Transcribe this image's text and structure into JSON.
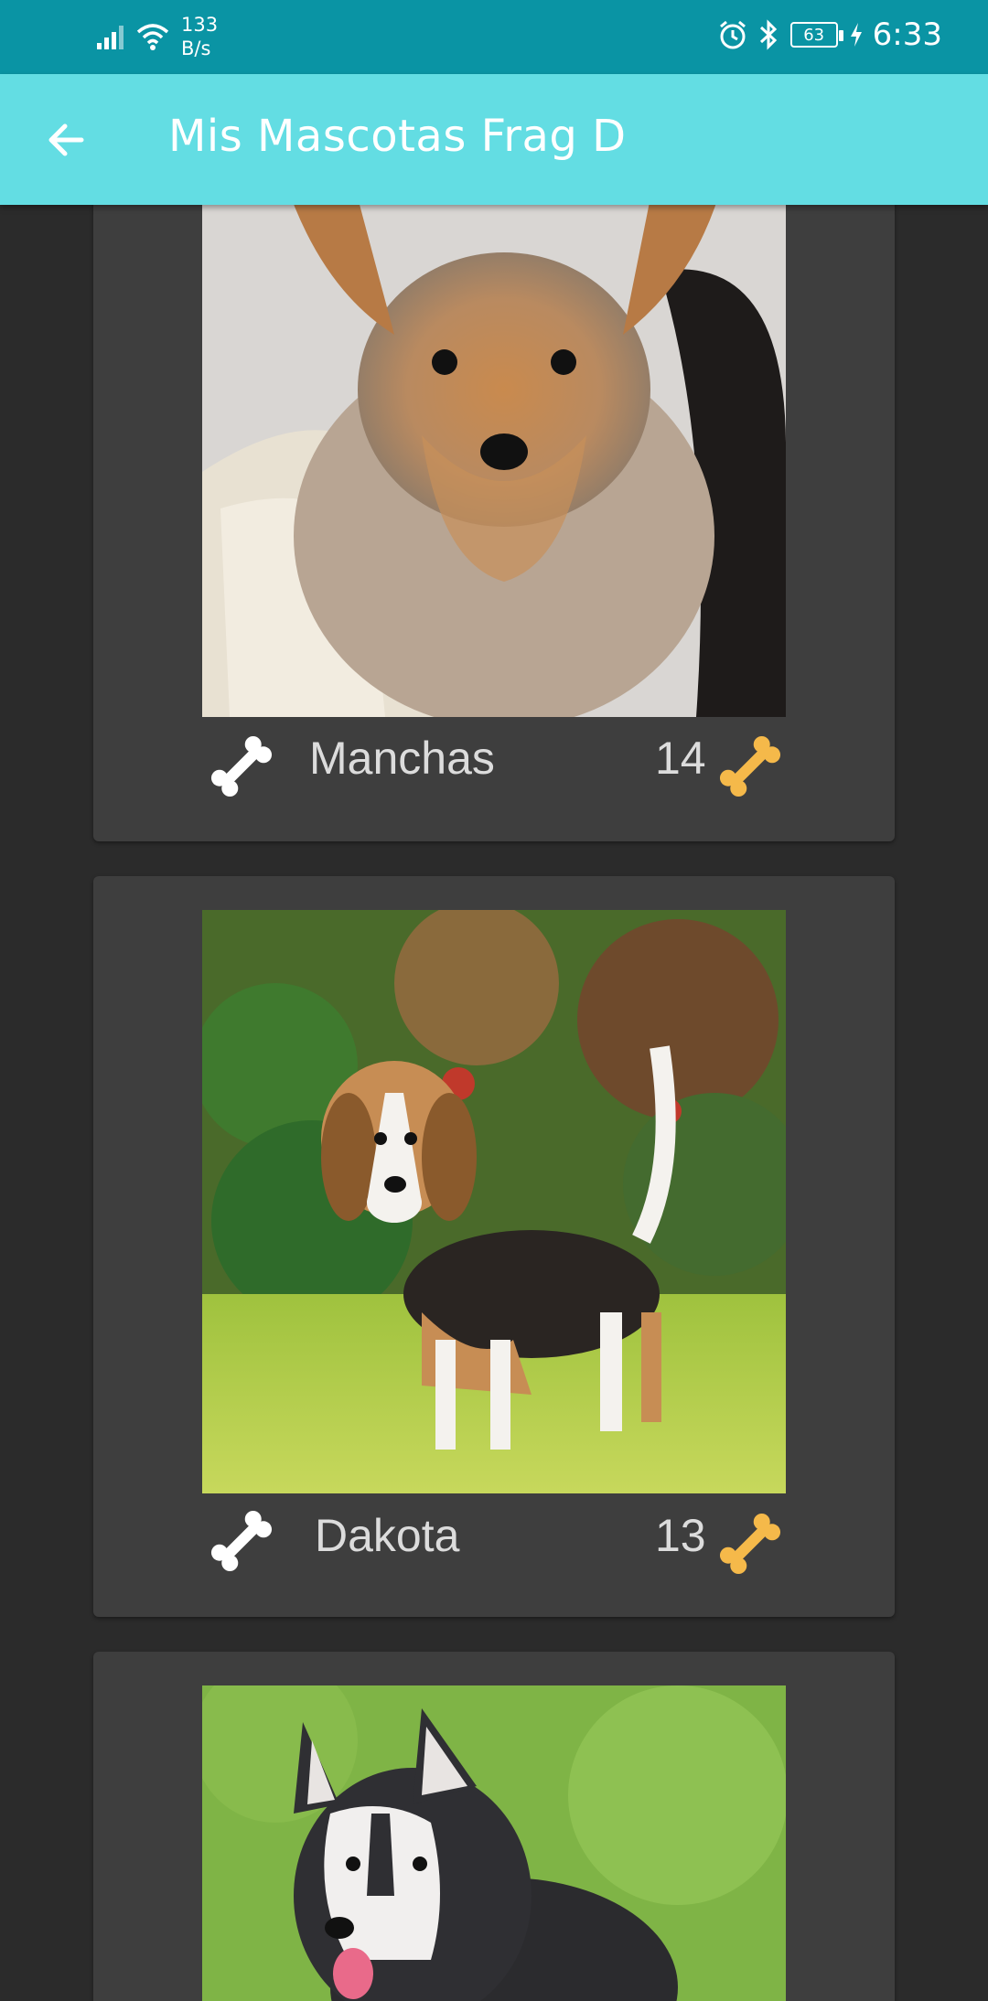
{
  "status_bar": {
    "net_speed_value": "133",
    "net_speed_unit": "B/s",
    "battery": "63",
    "time": "6:33"
  },
  "app_bar": {
    "title": "Mis Mascotas Frag D"
  },
  "pets": [
    {
      "name": "Manchas",
      "likes": "14"
    },
    {
      "name": "Dakota",
      "likes": "13"
    },
    {
      "name": "",
      "likes": ""
    }
  ],
  "colors": {
    "status_bar": "#0a94a4",
    "app_bar": "#63dde3",
    "background": "#2b2b2b",
    "card": "#3e3e3e",
    "bone_white": "#ffffff",
    "bone_gold": "#f5b94a"
  }
}
